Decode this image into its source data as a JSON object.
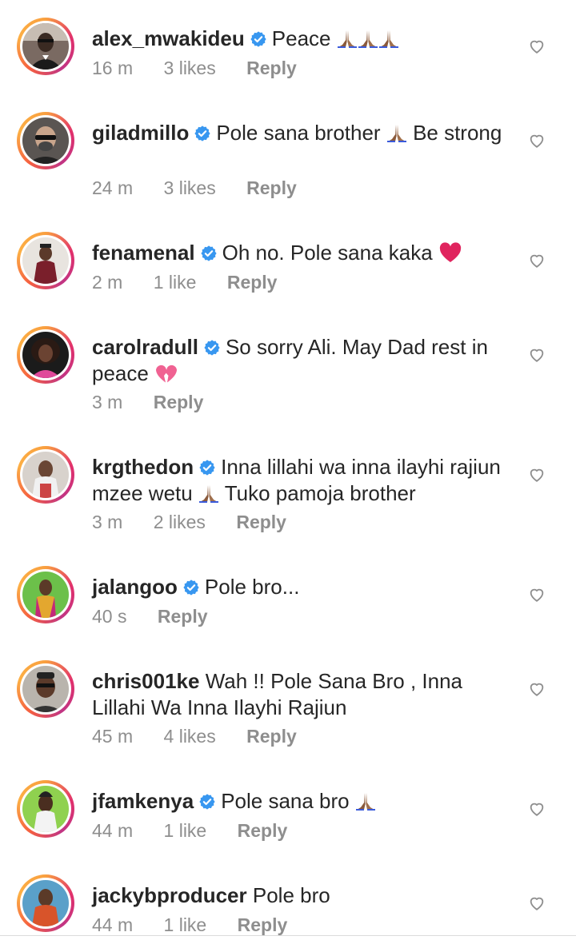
{
  "colors": {
    "text": "#262626",
    "secondary": "#8e8e8e",
    "verified": "#3897f0",
    "heart_red": "#e0245e"
  },
  "comments": [
    {
      "username": "alex_mwakideu",
      "verified": true,
      "text": "Peace",
      "emoji": [
        "folded-hands-emoji",
        "folded-hands-emoji",
        "folded-hands-emoji"
      ],
      "time": "16 m",
      "likes": "3 likes",
      "reply": "Reply"
    },
    {
      "username": "giladmillo",
      "verified": true,
      "text_before": "Pole sana brother",
      "emoji": [
        "folded-hands-emoji"
      ],
      "text_after": "Be strong",
      "time": "24 m",
      "likes": "3 likes",
      "reply": "Reply"
    },
    {
      "username": "fenamenal",
      "verified": true,
      "text": "Oh no. Pole sana kaka",
      "emoji": [
        "red-heart-emoji"
      ],
      "time": "2 m",
      "likes": "1 like",
      "reply": "Reply"
    },
    {
      "username": "carolradull",
      "verified": true,
      "text": "So sorry Ali. May Dad rest in peace",
      "emoji": [
        "broken-heart-emoji"
      ],
      "time": "3 m",
      "likes": "",
      "reply": "Reply"
    },
    {
      "username": "krgthedon",
      "verified": true,
      "text_before": "Inna lillahi wa inna ilayhi rajiun mzee wetu",
      "emoji": [
        "folded-hands-emoji"
      ],
      "text_after": "Tuko pamoja brother",
      "time": "3 m",
      "likes": "2 likes",
      "reply": "Reply"
    },
    {
      "username": "jalangoo",
      "verified": true,
      "text": "Pole bro...",
      "time": "40 s",
      "likes": "",
      "reply": "Reply"
    },
    {
      "username": "chris001ke",
      "verified": false,
      "text": "Wah !! Pole Sana Bro , Inna Lillahi Wa Inna Ilayhi Rajiun",
      "time": "45 m",
      "likes": "4 likes",
      "reply": "Reply"
    },
    {
      "username": "jfamkenya",
      "verified": true,
      "text": "Pole sana bro",
      "emoji": [
        "folded-hands-emoji"
      ],
      "time": "44 m",
      "likes": "1 like",
      "reply": "Reply"
    },
    {
      "username": "jackybproducer",
      "verified": false,
      "text": "Pole bro",
      "time": "44 m",
      "likes": "1 like",
      "reply": "Reply"
    }
  ]
}
